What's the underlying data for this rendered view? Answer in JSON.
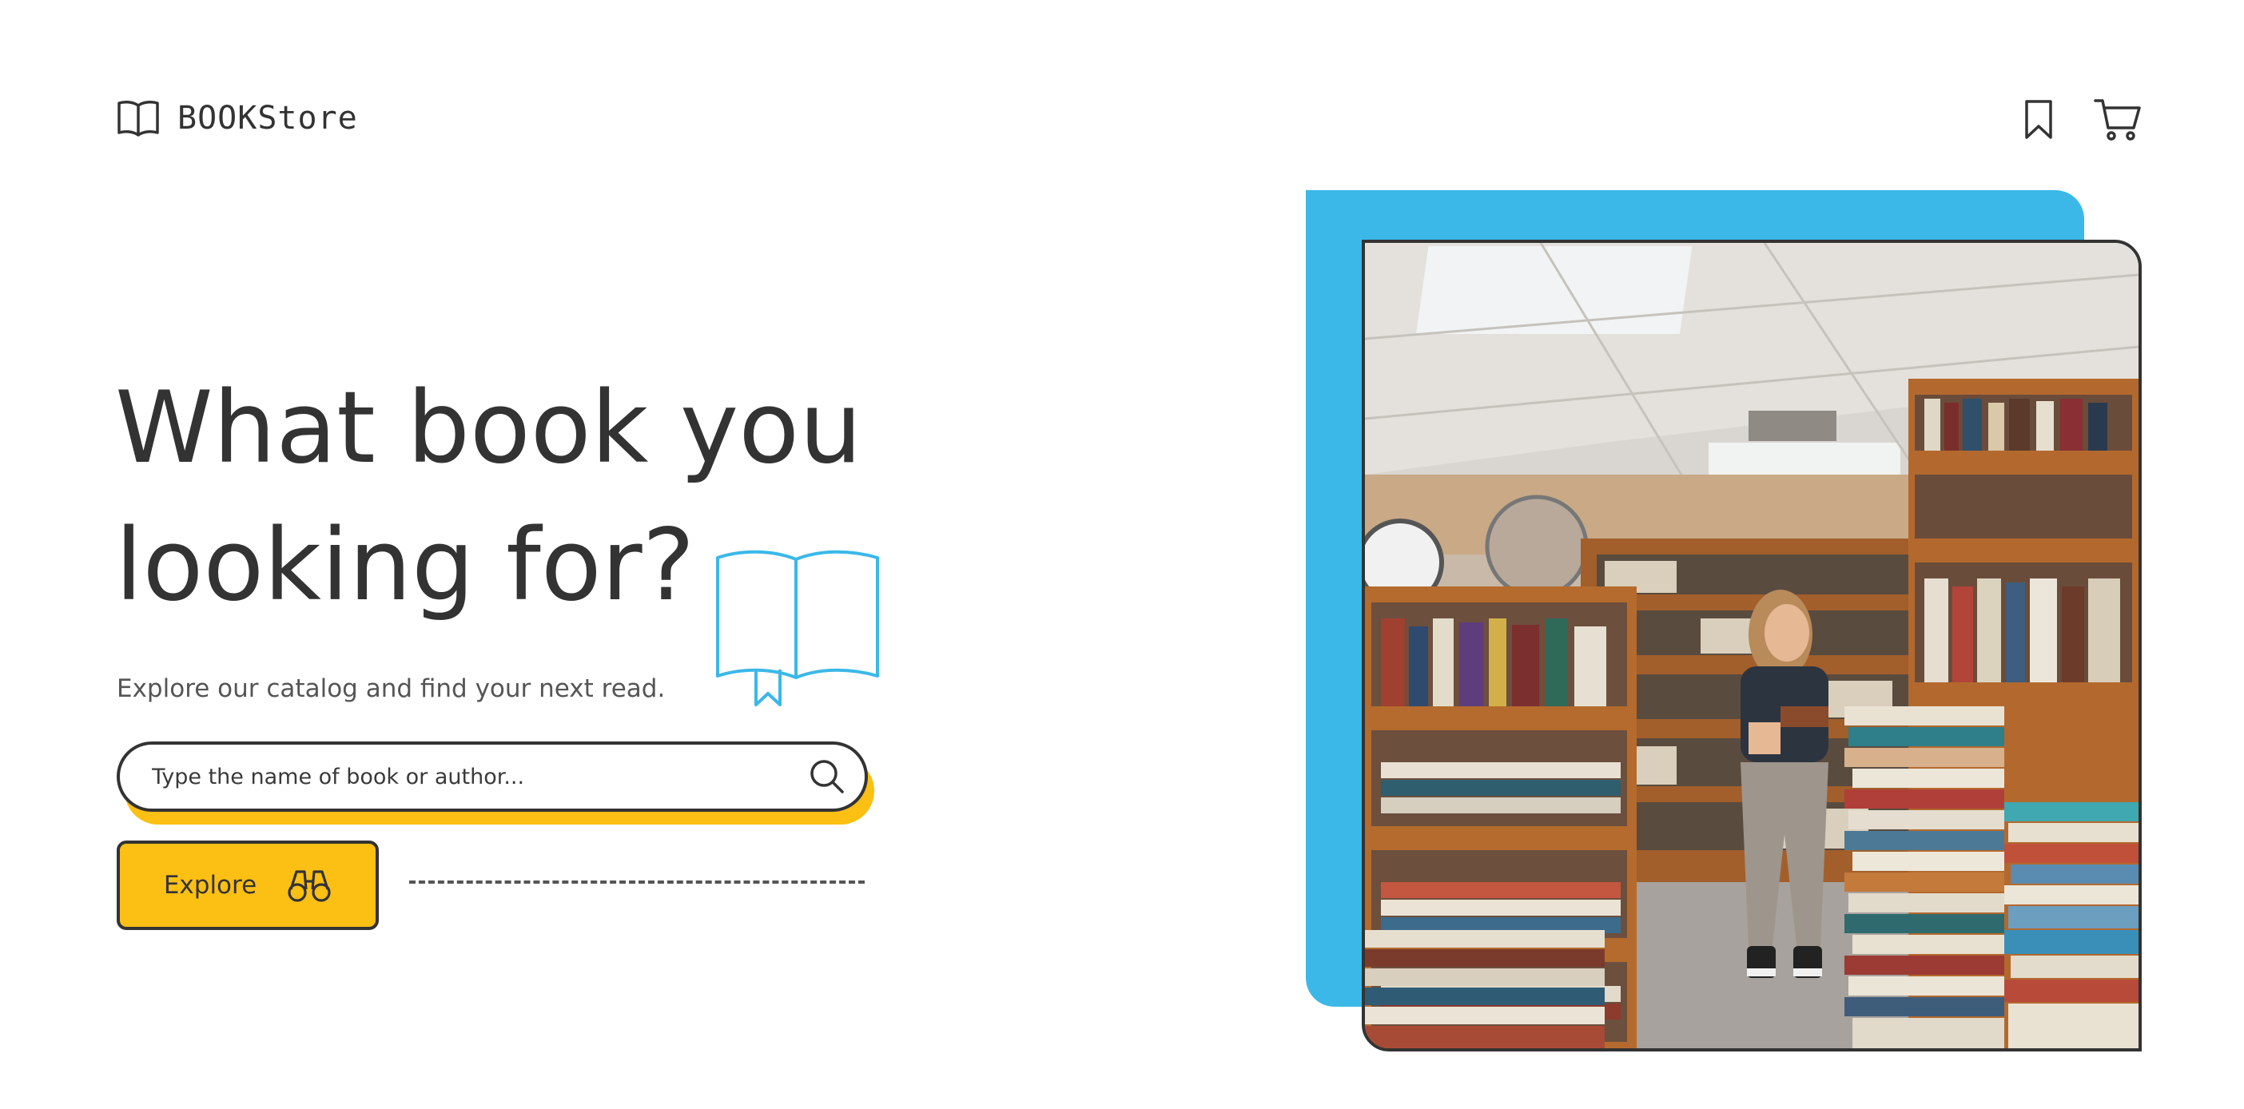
{
  "header": {
    "logo_text": "BOOKStore",
    "logo_icon": "open-book-icon",
    "nav_icons": [
      "bookmark-icon",
      "cart-icon"
    ]
  },
  "hero": {
    "headline_line1": "What book you",
    "headline_line2": "looking for?",
    "subtitle": "Explore our catalog and find your next read.",
    "search": {
      "placeholder": "Type the name of book or author...",
      "value": "",
      "icon": "search-icon"
    },
    "explore_button": {
      "label": "Explore",
      "icon": "binoculars-icon"
    }
  },
  "colors": {
    "accent_yellow": "#fcbf13",
    "accent_blue": "#3bb8e8",
    "text_dark": "#333333",
    "background": "#ffffff"
  }
}
